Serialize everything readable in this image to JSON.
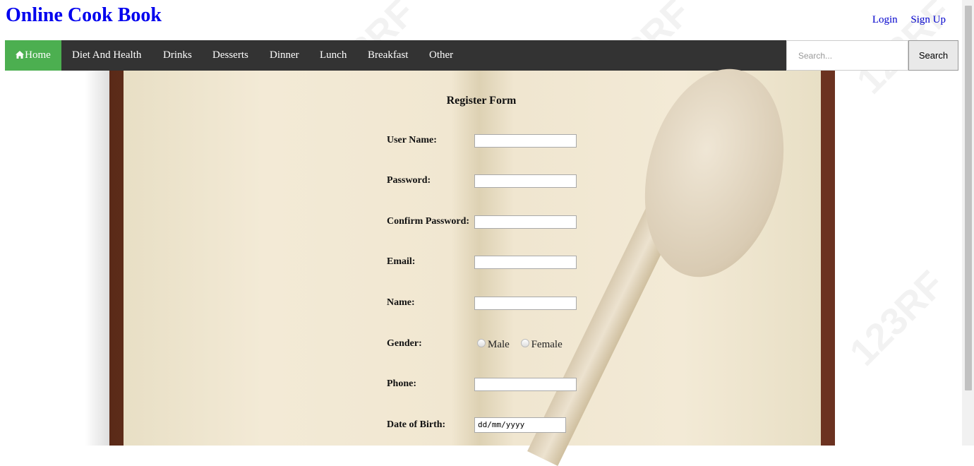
{
  "header": {
    "title": "Online Cook Book",
    "login": "Login",
    "signup": "Sign Up"
  },
  "nav": {
    "home": "Home",
    "items": [
      "Diet And Health",
      "Drinks",
      "Desserts",
      "Dinner",
      "Lunch",
      "Breakfast",
      "Other"
    ],
    "search_placeholder": "Search...",
    "search_button": "Search",
    "home_bg": "#4caf50",
    "bar_bg": "#333333"
  },
  "watermark": "123RF",
  "form": {
    "title": "Register Form",
    "username_label": "User Name:",
    "password_label": "Password:",
    "confirm_label": "Confirm Password:",
    "email_label": "Email:",
    "name_label": "Name:",
    "gender_label": "Gender:",
    "gender_options": [
      "Male",
      "Female"
    ],
    "phone_label": "Phone:",
    "dob_label": "Date of Birth:",
    "dob_placeholder": "dd/mm/yyyy"
  }
}
